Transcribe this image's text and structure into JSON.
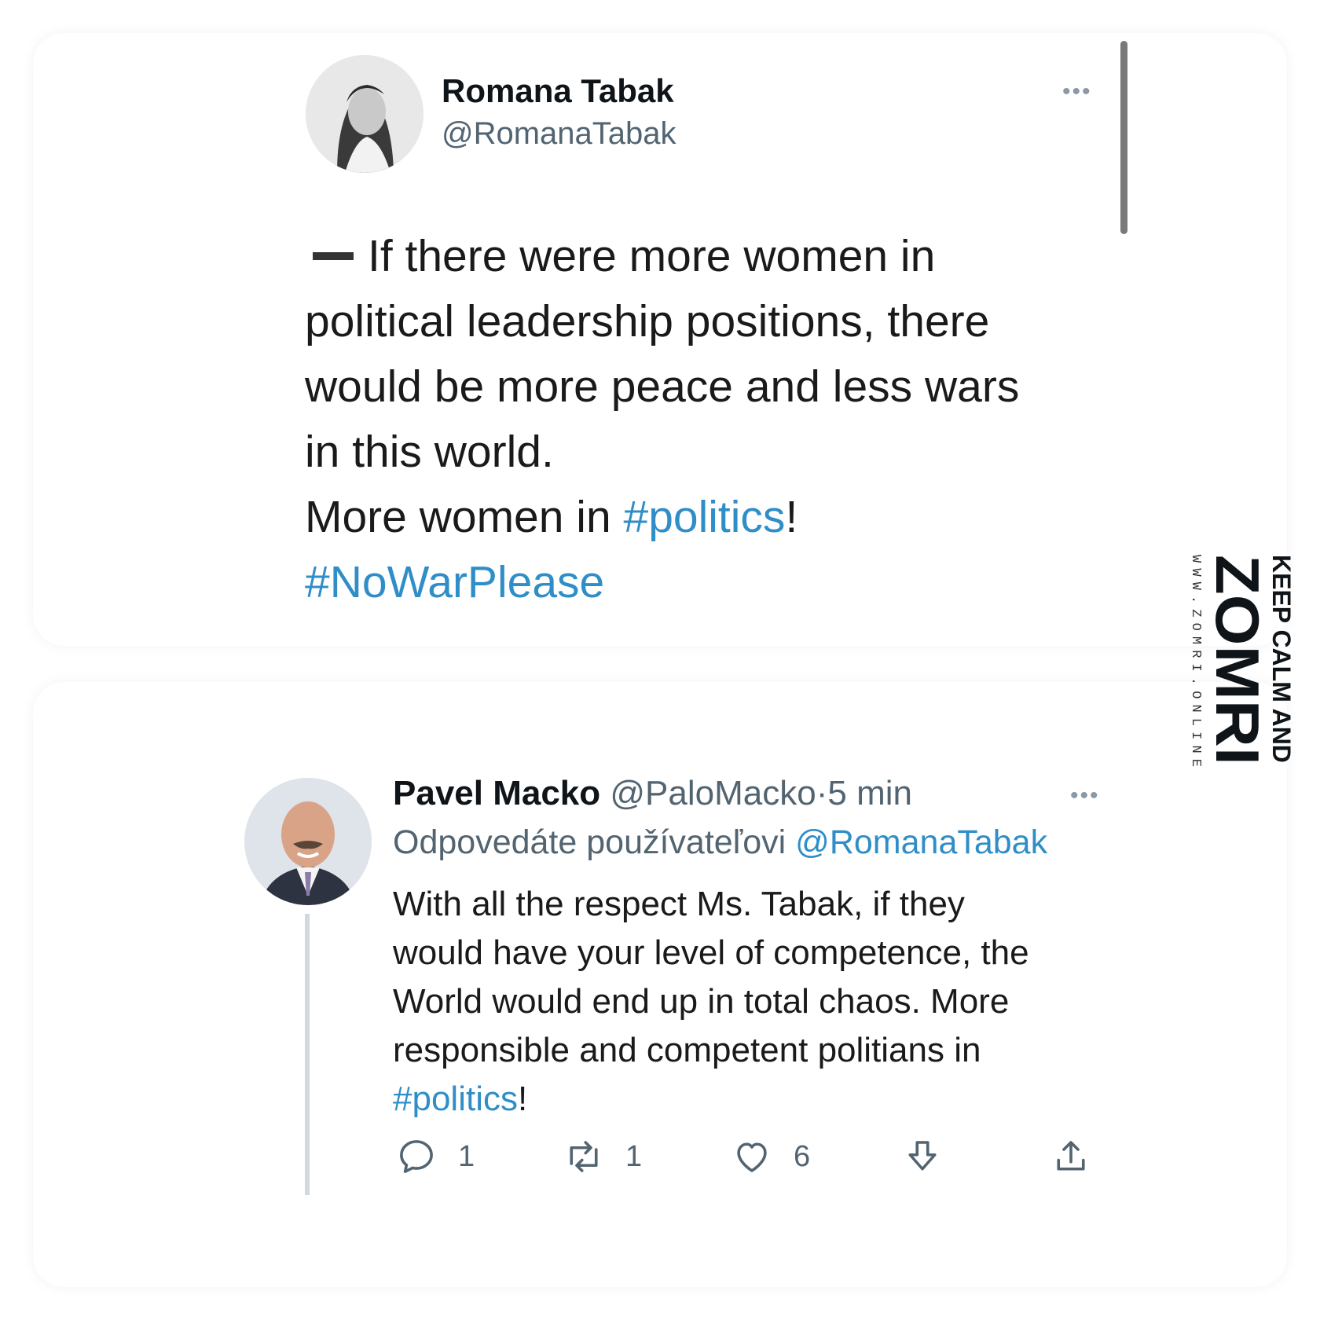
{
  "original_tweet": {
    "author_name": "Romana Tabak",
    "author_handle": "@RomanaTabak",
    "more_icon": "more-horizontal-icon",
    "lines": {
      "line1": "If there were more women in",
      "line2": "political leadership positions, there",
      "line3": "would be more peace and less wars",
      "line4": "in this world.",
      "line5_prefix": "More women in ",
      "line5_tag": "#politics",
      "line5_suffix": "!",
      "line6_tag": "#NoWarPlease"
    }
  },
  "reply_tweet": {
    "author_name": "Pavel Macko",
    "author_handle": "@PaloMacko",
    "separator": "·",
    "time": "5 min",
    "replying_prefix": "Odpovedáte používateľovi",
    "replying_mention": "@RomanaTabak",
    "lines": {
      "line1": "With all the respect Ms. Tabak,  if they",
      "line2": "would have your level of competence, the",
      "line3": "World would end up in total chaos. More",
      "line4": "responsible and competent politians in",
      "line5_tag": "#politics",
      "line5_suffix": "!"
    },
    "actions": {
      "reply_count": "1",
      "retweet_count": "1",
      "like_count": "6"
    }
  },
  "watermark": {
    "line1": "KEEP CALM AND",
    "logo": "ZOMRI",
    "url": "WWW.ZOMRI.ONLINE"
  },
  "colors": {
    "link": "#2f8ec7",
    "muted": "#536471",
    "text": "#0f1419"
  }
}
